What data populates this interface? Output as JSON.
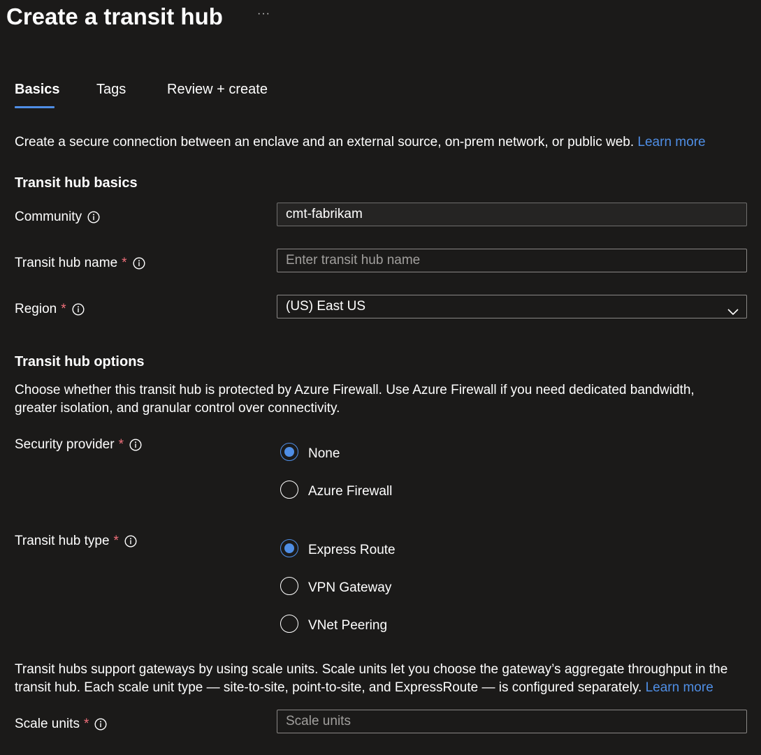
{
  "header": {
    "title": "Create a transit hub",
    "more_label": "···"
  },
  "tabs": [
    {
      "label": "Basics",
      "active": true
    },
    {
      "label": "Tags",
      "active": false
    },
    {
      "label": "Review + create",
      "active": false
    }
  ],
  "intro": {
    "text": "Create a secure connection between an enclave and an external source, on-prem network, or public web.",
    "link": "Learn more"
  },
  "basics": {
    "heading": "Transit hub basics",
    "community": {
      "label": "Community",
      "value": "cmt-fabrikam",
      "icon": "info-icon"
    },
    "name": {
      "label": "Transit hub name",
      "required": "*",
      "placeholder": "Enter transit hub name",
      "value": "",
      "icon": "info-icon"
    },
    "region": {
      "label": "Region",
      "required": "*",
      "value": "(US) East US",
      "icon": "chevron-down-icon"
    }
  },
  "options": {
    "heading": "Transit hub options",
    "description_line1": "Choose whether this transit hub is protected by Azure Firewall. Use Azure Firewall if you need dedicated bandwidth,",
    "description_line2": "greater isolation, and granular control over connectivity.",
    "security_provider": {
      "label": "Security provider",
      "required": "*",
      "options": [
        {
          "label": "None",
          "selected": true
        },
        {
          "label": "Azure Firewall",
          "selected": false
        }
      ]
    },
    "hub_type": {
      "label": "Transit hub type",
      "required": "*",
      "options": [
        {
          "label": "Express Route",
          "selected": true
        },
        {
          "label": "VPN Gateway",
          "selected": false
        },
        {
          "label": "VNet Peering",
          "selected": false
        }
      ]
    }
  },
  "scale": {
    "description_line1": "Transit hubs support gateways by using scale units. Scale units let you choose the gateway’s aggregate throughput in the",
    "description_line2": "transit hub. Each scale unit type — site-to-site, point-to-site, and ExpressRoute — is configured separately.",
    "link": "Learn more",
    "label": "Scale units",
    "required": "*",
    "placeholder": "Scale units",
    "value": ""
  },
  "colors": {
    "background": "#1b1a19",
    "accent": "#4f8ee5",
    "required": "#f1707b",
    "border": "#8a8886"
  }
}
